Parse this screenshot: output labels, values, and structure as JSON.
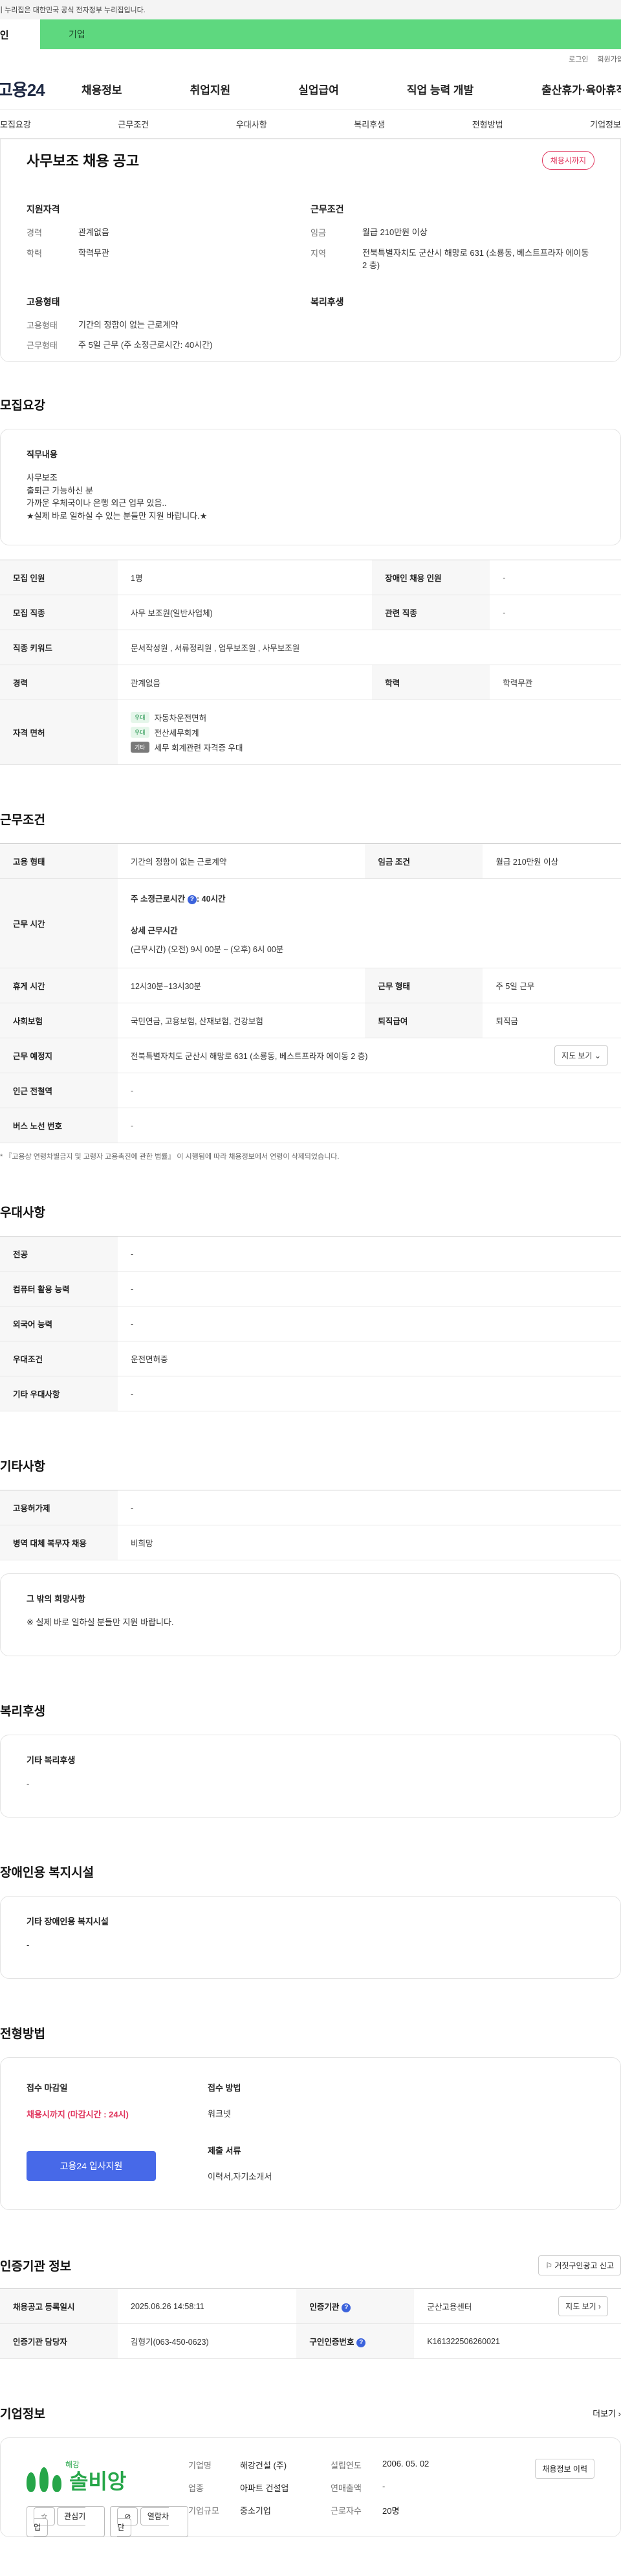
{
  "gov_banner": "이 누리집은 대한민국 공식 전자정부 누리집입니다.",
  "user_tabs": {
    "individual": "개인",
    "company": "기업"
  },
  "util_links": [
    "로그인",
    "회원가입"
  ],
  "logo": "고용24",
  "gnb": [
    "채용정보",
    "취업지원",
    "실업급여",
    "직업 능력 개발",
    "출산휴가·육아휴직"
  ],
  "anchor_tabs": [
    "모집요강",
    "근무조건",
    "우대사항",
    "복리후생",
    "전형방법",
    "기업정보"
  ],
  "summary": {
    "title": "사무보조 채용 공고",
    "deadline_badge": "채용시까지",
    "qual_heading": "지원자격",
    "qual_rows": [
      {
        "label": "경력",
        "value": "관계없음"
      },
      {
        "label": "학력",
        "value": "학력무관"
      }
    ],
    "work_heading": "근무조건",
    "work_rows": [
      {
        "label": "임금",
        "value": "월급 210만원 이상"
      },
      {
        "label": "지역",
        "value": "전북특별자치도 군산시 해망로 631 (소룡동, 베스트프라자 에이동 2 층)"
      }
    ],
    "emp_heading": "고용형태",
    "emp_rows": [
      {
        "label": "고용형태",
        "value": "기간의 정함이 없는 근로계약"
      },
      {
        "label": "근무형태",
        "value": "주 5일 근무 (주 소정근로시간: 40시간)"
      }
    ],
    "welfare_heading": "복리후생"
  },
  "recruit": {
    "title": "모집요강",
    "duty_title": "직무내용",
    "duty_lines": [
      "사무보조",
      "출퇴근 가능하신 분",
      "가까운 우체국이나 은행 외근 업무 있음..",
      "★실제 바로 일하실 수 있는 분들만 지원 바랍니다.★"
    ],
    "rows": [
      {
        "k1": "모집 인원",
        "v1": "1명",
        "k2": "장애인 채용 인원",
        "v2": "-"
      },
      {
        "k1": "모집 직종",
        "v1": "사무 보조원(일반사업체)",
        "k2": "관련 직종",
        "v2": "-"
      },
      {
        "k1": "직종 키워드",
        "v1": "문서작성원 , 서류정리원 , 업무보조원 , 사무보조원"
      },
      {
        "k1": "경력",
        "v1": "관계없음",
        "k2": "학력",
        "v2": "학력무관"
      }
    ],
    "license_label": "자격 면허",
    "licenses": [
      {
        "badge": "우대",
        "name": "자동차운전면허"
      },
      {
        "badge": "우대",
        "name": "전산세무회계"
      },
      {
        "badge": "기타",
        "name": "세무 회계관련 자격증 우대"
      }
    ]
  },
  "work": {
    "title": "근무조건",
    "emp_type_label": "고용 형태",
    "emp_type": "기간의 정함이 없는 근로계약",
    "wage_label": "임금 조건",
    "wage": "월급 210만원 이상",
    "hours_label": "근무 시간",
    "hours_total_label": "주 소정근로시간",
    "hours_total": ": 40시간",
    "hours_detail_label": "상세 근무시간",
    "hours_detail": "(근무시간) (오전) 9시 00분 ~ (오후) 6시 00분",
    "break_label": "휴게 시간",
    "break": "12시30분~13시30분",
    "worktype_label": "근무 형태",
    "worktype": "주 5일 근무",
    "insurance_label": "사회보험",
    "insurance": "국민연금, 고용보험, 산재보험, 건강보험",
    "severance_label": "퇴직급여",
    "severance": "퇴직금",
    "location_label": "근무 예정지",
    "location": "전북특별자치도 군산시 해망로 631 (소룡동, 베스트프라자 에이동 2 층)",
    "map_button": "지도 보기",
    "subway_label": "인근 전철역",
    "subway": "-",
    "bus_label": "버스 노선 번호",
    "bus": "-",
    "note": "* 『고용상 연령차별금지 및 고령자 고용촉진에 관한 법률』 이 시행됨에 따라 채용정보에서 연령이 삭제되었습니다."
  },
  "pref": {
    "title": "우대사항",
    "rows": [
      {
        "k": "전공",
        "v": "-"
      },
      {
        "k": "컴퓨터 활용 능력",
        "v": "-"
      },
      {
        "k": "외국어 능력",
        "v": "-"
      },
      {
        "k": "우대조건",
        "v": "운전면허증"
      },
      {
        "k": "기타 우대사항",
        "v": "-"
      }
    ]
  },
  "etc": {
    "title": "기타사항",
    "rows": [
      {
        "k": "고용허가제",
        "v": "-"
      },
      {
        "k": "병역 대체 복무자 채용",
        "v": "비희망"
      }
    ],
    "box_title": "그 밖의 희망사항",
    "box_text": "※ 실제 바로 일하실  분들만 지원 바랍니다."
  },
  "welfare": {
    "title": "복리후생",
    "box_title": "기타 복리후생",
    "box_text": "-"
  },
  "disabled": {
    "title": "장애인용 복지시설",
    "box_title": "기타 장애인용 복지시설",
    "box_text": "-"
  },
  "selection": {
    "title": "전형방법",
    "deadline_label": "접수 마감일",
    "deadline": "채용시까지 (마감시간 : 24시)",
    "apply_button": "고용24 입사지원",
    "method_label": "접수 방법",
    "method": "워크넷",
    "docs_label": "제출 서류",
    "docs": "이력서,자기소개서"
  },
  "cert": {
    "title": "인증기관 정보",
    "report_button": "거짓구인광고 신고",
    "reg_label": "채용공고 등록일시",
    "reg": "2025.06.26 14:58:11",
    "agency_label": "인증기관",
    "agency": "군산고용센터",
    "map_button": "지도 보기",
    "manager_label": "인증기관 담당자",
    "manager": "김형기(063-450-0623)",
    "no_label": "구인인증번호",
    "no": "K161322506260021"
  },
  "company": {
    "title": "기업정보",
    "more": "더보기",
    "logo_small": "해강",
    "logo_big": "솔비앙",
    "fav_button": "관심기업",
    "block_button": "열람차단",
    "history_button": "채용정보 이력",
    "name_label": "기업명",
    "name": "해강건설 (주)",
    "year_label": "설립연도",
    "year": "2006. 05. 02",
    "industry_label": "업종",
    "industry": "아파트 건설업",
    "sales_label": "연매출액",
    "sales": "-",
    "scale_label": "기업규모",
    "scale": "중소기업",
    "staff_label": "근로자수",
    "staff": "20명"
  }
}
